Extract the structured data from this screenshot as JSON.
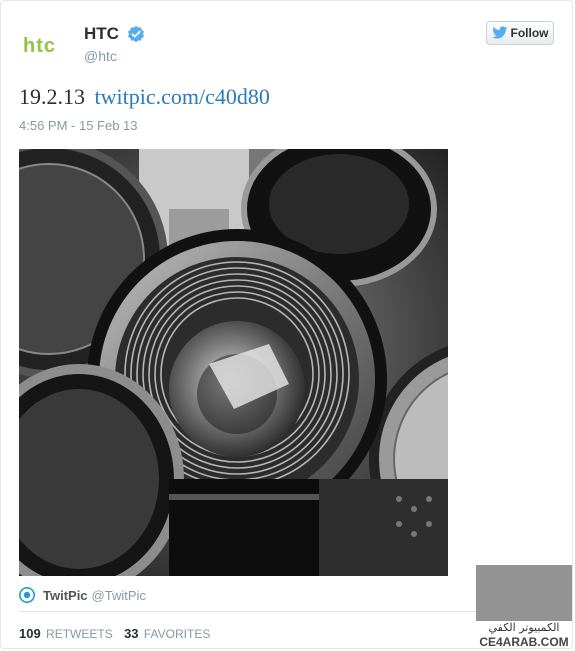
{
  "header": {
    "account_name": "HTC",
    "account_handle": "@htc",
    "follow_label": "Follow",
    "logo_text": "htc"
  },
  "tweet": {
    "text": "19.2.13",
    "link": "twitpic.com/c40d80",
    "timestamp": "4:56 PM - 15 Feb 13"
  },
  "source": {
    "name": "TwitPic",
    "handle": "@TwitPic"
  },
  "stats": {
    "retweets_count": "109",
    "retweets_label": "RETWEETS",
    "favorites_count": "33",
    "favorites_label": "FAVORITES"
  },
  "watermark": {
    "arabic": "الكمبيوتر الكفي",
    "site": "CE4ARAB.COM"
  },
  "colors": {
    "htc_green": "#8dc63f",
    "verified_blue": "#55acee",
    "link_blue": "#2b7bb9",
    "muted": "#8899a6",
    "text": "#292f33"
  }
}
